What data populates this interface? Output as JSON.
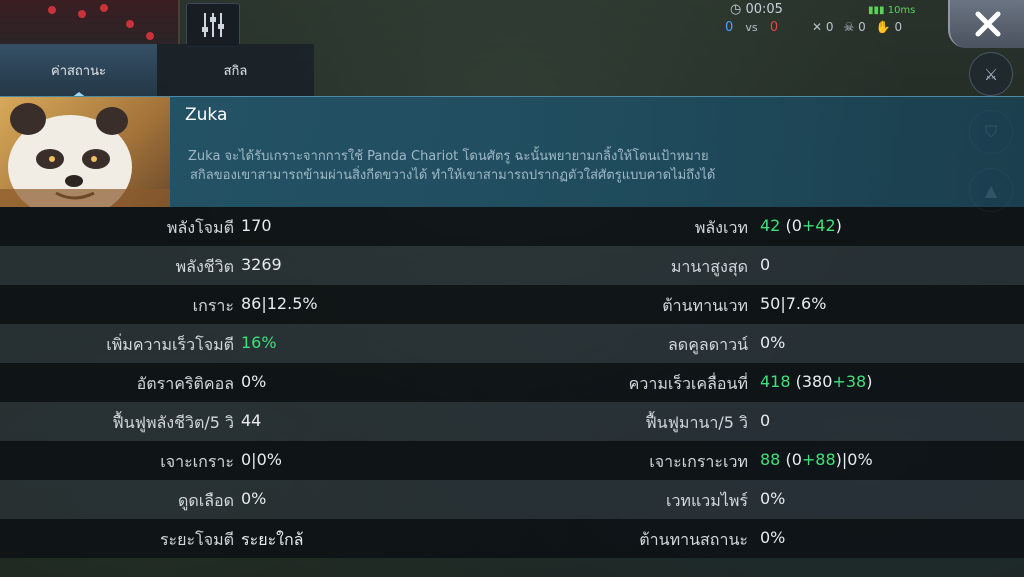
{
  "hud": {
    "timer": "00:05",
    "blue_score": "0",
    "vs": "vs",
    "red_score": "0",
    "kills": "0",
    "deaths": "0",
    "assists": "0",
    "ping": "10ms"
  },
  "tabs": [
    {
      "label": "ค่าสถานะ",
      "active": true
    },
    {
      "label": "สกิล",
      "active": false
    }
  ],
  "hero": {
    "name": "Zuka",
    "description_line1": "Zuka จะได้รับเกราะจากการใช้ Panda Chariot โดนศัตรู ฉะนั้นพยายามกลิ้งให้โดนเป้าหมาย",
    "description_line2": "สกิลของเขาสามารถข้ามผ่านสิ่งกีดขวางได้ ทำให้เขาสามารถปรากฏตัวใส่ศัตรูแบบคาดไม่ถึงได้"
  },
  "stats": [
    {
      "left_label": "พลังโจมตี",
      "left_value": "170",
      "left_extra": "",
      "right_label": "พลังเวท",
      "right_value": "42",
      "right_extra": " (0+42)"
    },
    {
      "left_label": "พลังชีวิต",
      "left_value": "3269",
      "left_extra": "",
      "right_label": "มานาสูงสุด",
      "right_value": "0",
      "right_extra": ""
    },
    {
      "left_label": "เกราะ",
      "left_value": "86|12.5%",
      "left_extra": "",
      "right_label": "ต้านทานเวท",
      "right_value": "50|7.6%",
      "right_extra": ""
    },
    {
      "left_label": "เพิ่มความเร็วโจมตี",
      "left_value": "16%",
      "left_extra": "",
      "right_label": "ลดคูลดาวน์",
      "right_value": "0%",
      "right_extra": ""
    },
    {
      "left_label": "อัตราคริติคอล",
      "left_value": "0%",
      "left_extra": "",
      "right_label": "ความเร็วเคลื่อนที่",
      "right_value": "418",
      "right_extra": " (380+38)"
    },
    {
      "left_label": "ฟื้นฟูพลังชีวิต/5 วิ",
      "left_value": "44",
      "left_extra": "",
      "right_label": "ฟื้นฟูมานา/5 วิ",
      "right_value": "0",
      "right_extra": ""
    },
    {
      "left_label": "เจาะเกราะ",
      "left_value": "0|0%",
      "left_extra": "",
      "right_label": "เจาะเกราะเวท",
      "right_value": "88",
      "right_extra": " (0+88)|0%"
    },
    {
      "left_label": "ดูดเลือด",
      "left_value": "0%",
      "left_extra": "",
      "right_label": "เวทแวมไพร์",
      "right_value": "0%",
      "right_extra": ""
    },
    {
      "left_label": "ระยะโจมตี",
      "left_value": "ระยะใกล้",
      "left_extra": "",
      "right_label": "ต้านทานสถานะ",
      "right_value": "0%",
      "right_extra": ""
    }
  ],
  "colors": {
    "bonus_green": "#3fe07a",
    "panel_blue": "#265a6e",
    "tab_active": "#355066"
  },
  "icons": {
    "close": "close-icon",
    "settings": "sliders-icon",
    "timer": "clock-icon"
  }
}
